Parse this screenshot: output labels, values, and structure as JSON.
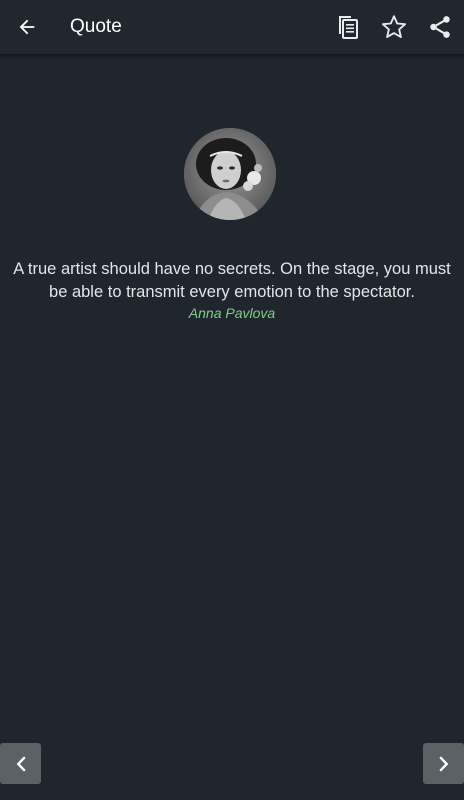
{
  "app_bar": {
    "title": "Quote",
    "icons": [
      "arrow-back-icon",
      "copy-icon",
      "star-outline-icon",
      "share-icon"
    ]
  },
  "quote": {
    "text": "A true artist should have no secrets. On the stage, you must be able to transmit every emotion to the spectator.",
    "author": "Anna Pavlova"
  },
  "navigation": {
    "icons": [
      "chevron-left-icon",
      "chevron-right-icon"
    ]
  },
  "colors": {
    "background": "#1f262d",
    "app_bar": "#20272e",
    "quote_text": "#e3e6e8",
    "author_accent": "#7fd088",
    "nav_button": "#5c6166"
  }
}
